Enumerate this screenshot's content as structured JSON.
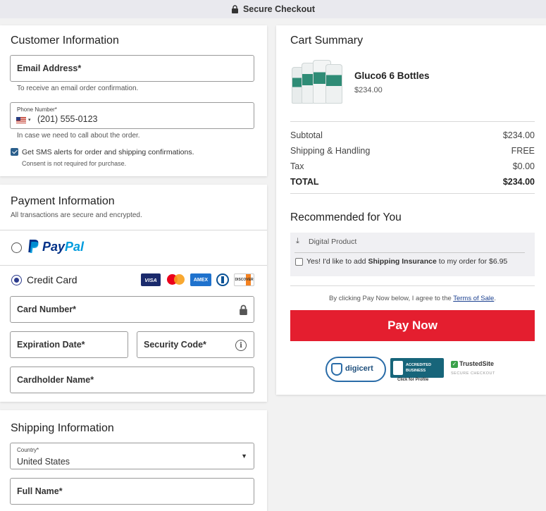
{
  "topbar": {
    "title": "Secure Checkout"
  },
  "customer": {
    "title": "Customer Information",
    "email_label": "Email Address*",
    "email_hint": "To receive an email order confirmation.",
    "phone_label": "Phone Number*",
    "phone_value": "(201) 555-0123",
    "phone_hint": "In case we need to call about the order.",
    "sms_label": "Get SMS alerts for order and shipping confirmations.",
    "sms_checked": true,
    "sms_hint": "Consent is not required for purchase."
  },
  "payment": {
    "title": "Payment Information",
    "subtitle": "All transactions are secure and encrypted.",
    "paypal_pay": "Pay",
    "paypal_pal": "Pal",
    "credit_label": "Credit Card",
    "card_brands": [
      "VISA",
      "AMEX",
      "DISCOVER"
    ],
    "card_number_label": "Card Number*",
    "expiration_label": "Expiration Date*",
    "security_label": "Security Code*",
    "cardholder_label": "Cardholder Name*"
  },
  "shipping": {
    "title": "Shipping Information",
    "country_label": "Country*",
    "country_value": "United States",
    "fullname_label": "Full Name*"
  },
  "cart": {
    "title": "Cart Summary",
    "product_name": "Gluco6 6 Bottles",
    "product_price": "$234.00",
    "rows": [
      {
        "label": "Subtotal",
        "value": "$234.00"
      },
      {
        "label": "Shipping & Handling",
        "value": "FREE"
      },
      {
        "label": "Tax",
        "value": "$0.00"
      },
      {
        "label": "TOTAL",
        "value": "$234.00"
      }
    ]
  },
  "recommended": {
    "title": "Recommended for You",
    "digital_label": "Digital Product",
    "insurance_pre": "Yes! I'd like to add ",
    "insurance_bold": "Shipping Insurance",
    "insurance_post": " to my order for $6.95"
  },
  "terms": {
    "pre": "By clicking Pay Now below, I agree to the ",
    "link": "Terms of Sale",
    "post": "."
  },
  "pay_button": "Pay Now",
  "badges": {
    "digicert": "digicert",
    "bbb_line1": "ACCREDITED",
    "bbb_line2": "BUSINESS",
    "bbb_caption": "Click for Profile",
    "trusted": "TrustedSite",
    "trusted_sub": "SECURE CHECKOUT"
  },
  "colors": {
    "accent_red": "#e41e2f",
    "paypal_dark": "#003087",
    "paypal_light": "#009cde",
    "link_blue": "#1a3f8f"
  }
}
